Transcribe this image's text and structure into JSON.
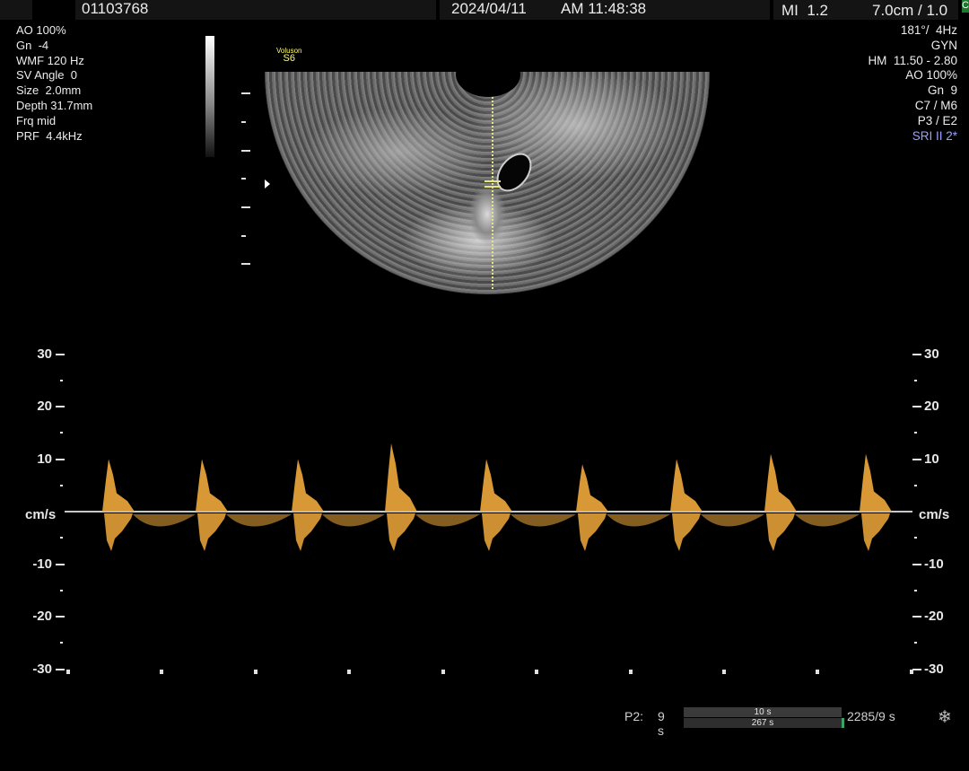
{
  "header": {
    "patient_id": "01103768",
    "date": "2024/04/11",
    "time": "AM 11:48:38",
    "mi": "MI  1.2",
    "depth_zoom": "7.0cm / 1.0",
    "status_box": "C"
  },
  "doppler_params": [
    "AO 100%",
    "Gn  -4",
    "WMF 120 Hz",
    "SV Angle  0",
    "Size  2.0mm",
    "Depth 31.7mm",
    "Frq mid",
    "PRF  4.4kHz"
  ],
  "image_params": [
    "181°/  4Hz",
    "GYN",
    "HM  11.50 - 2.80",
    "AO 100%",
    "Gn  9",
    "C7 / M6",
    "P3 / E2"
  ],
  "sri_label": "SRI II 2*",
  "logo": {
    "brand": "Voluson",
    "model": "S6"
  },
  "velocity_scale": {
    "unit": "cm/s",
    "labels": [
      "30",
      "20",
      "10",
      "-10",
      "-20",
      "-30"
    ]
  },
  "spectrum": {
    "color": "#f0a93c",
    "peak_velocity_cm_s": [
      10,
      10,
      10,
      13,
      10,
      9,
      10,
      11,
      11
    ]
  },
  "footer": {
    "probe_label": "P2:",
    "time_left": "9 s",
    "bar_top": "10 s",
    "bar_bottom": "267 s",
    "frames": "2285/9 s",
    "settings_icon": "snowflake-icon"
  }
}
